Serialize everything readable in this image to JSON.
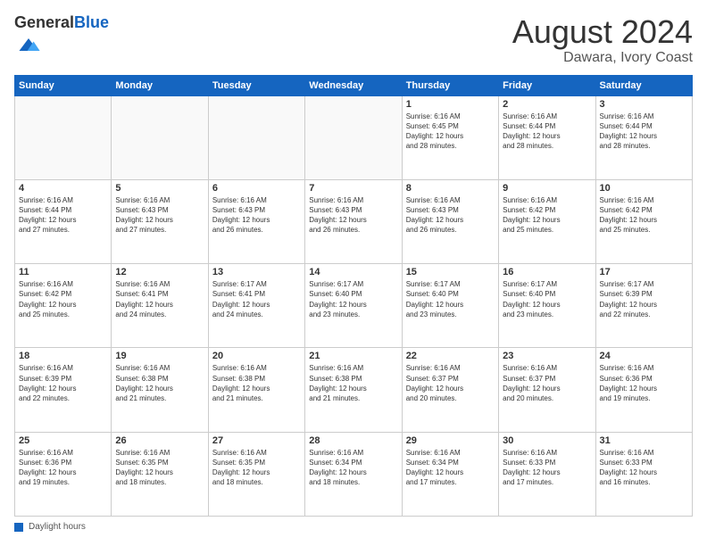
{
  "logo": {
    "general": "General",
    "blue": "Blue"
  },
  "header": {
    "month": "August 2024",
    "location": "Dawara, Ivory Coast"
  },
  "days_of_week": [
    "Sunday",
    "Monday",
    "Tuesday",
    "Wednesday",
    "Thursday",
    "Friday",
    "Saturday"
  ],
  "footer": {
    "daylight_hours_label": "Daylight hours"
  },
  "weeks": [
    [
      {
        "day": "",
        "info": ""
      },
      {
        "day": "",
        "info": ""
      },
      {
        "day": "",
        "info": ""
      },
      {
        "day": "",
        "info": ""
      },
      {
        "day": "1",
        "info": "Sunrise: 6:16 AM\nSunset: 6:45 PM\nDaylight: 12 hours\nand 28 minutes."
      },
      {
        "day": "2",
        "info": "Sunrise: 6:16 AM\nSunset: 6:44 PM\nDaylight: 12 hours\nand 28 minutes."
      },
      {
        "day": "3",
        "info": "Sunrise: 6:16 AM\nSunset: 6:44 PM\nDaylight: 12 hours\nand 28 minutes."
      }
    ],
    [
      {
        "day": "4",
        "info": "Sunrise: 6:16 AM\nSunset: 6:44 PM\nDaylight: 12 hours\nand 27 minutes."
      },
      {
        "day": "5",
        "info": "Sunrise: 6:16 AM\nSunset: 6:43 PM\nDaylight: 12 hours\nand 27 minutes."
      },
      {
        "day": "6",
        "info": "Sunrise: 6:16 AM\nSunset: 6:43 PM\nDaylight: 12 hours\nand 26 minutes."
      },
      {
        "day": "7",
        "info": "Sunrise: 6:16 AM\nSunset: 6:43 PM\nDaylight: 12 hours\nand 26 minutes."
      },
      {
        "day": "8",
        "info": "Sunrise: 6:16 AM\nSunset: 6:43 PM\nDaylight: 12 hours\nand 26 minutes."
      },
      {
        "day": "9",
        "info": "Sunrise: 6:16 AM\nSunset: 6:42 PM\nDaylight: 12 hours\nand 25 minutes."
      },
      {
        "day": "10",
        "info": "Sunrise: 6:16 AM\nSunset: 6:42 PM\nDaylight: 12 hours\nand 25 minutes."
      }
    ],
    [
      {
        "day": "11",
        "info": "Sunrise: 6:16 AM\nSunset: 6:42 PM\nDaylight: 12 hours\nand 25 minutes."
      },
      {
        "day": "12",
        "info": "Sunrise: 6:16 AM\nSunset: 6:41 PM\nDaylight: 12 hours\nand 24 minutes."
      },
      {
        "day": "13",
        "info": "Sunrise: 6:17 AM\nSunset: 6:41 PM\nDaylight: 12 hours\nand 24 minutes."
      },
      {
        "day": "14",
        "info": "Sunrise: 6:17 AM\nSunset: 6:40 PM\nDaylight: 12 hours\nand 23 minutes."
      },
      {
        "day": "15",
        "info": "Sunrise: 6:17 AM\nSunset: 6:40 PM\nDaylight: 12 hours\nand 23 minutes."
      },
      {
        "day": "16",
        "info": "Sunrise: 6:17 AM\nSunset: 6:40 PM\nDaylight: 12 hours\nand 23 minutes."
      },
      {
        "day": "17",
        "info": "Sunrise: 6:17 AM\nSunset: 6:39 PM\nDaylight: 12 hours\nand 22 minutes."
      }
    ],
    [
      {
        "day": "18",
        "info": "Sunrise: 6:16 AM\nSunset: 6:39 PM\nDaylight: 12 hours\nand 22 minutes."
      },
      {
        "day": "19",
        "info": "Sunrise: 6:16 AM\nSunset: 6:38 PM\nDaylight: 12 hours\nand 21 minutes."
      },
      {
        "day": "20",
        "info": "Sunrise: 6:16 AM\nSunset: 6:38 PM\nDaylight: 12 hours\nand 21 minutes."
      },
      {
        "day": "21",
        "info": "Sunrise: 6:16 AM\nSunset: 6:38 PM\nDaylight: 12 hours\nand 21 minutes."
      },
      {
        "day": "22",
        "info": "Sunrise: 6:16 AM\nSunset: 6:37 PM\nDaylight: 12 hours\nand 20 minutes."
      },
      {
        "day": "23",
        "info": "Sunrise: 6:16 AM\nSunset: 6:37 PM\nDaylight: 12 hours\nand 20 minutes."
      },
      {
        "day": "24",
        "info": "Sunrise: 6:16 AM\nSunset: 6:36 PM\nDaylight: 12 hours\nand 19 minutes."
      }
    ],
    [
      {
        "day": "25",
        "info": "Sunrise: 6:16 AM\nSunset: 6:36 PM\nDaylight: 12 hours\nand 19 minutes."
      },
      {
        "day": "26",
        "info": "Sunrise: 6:16 AM\nSunset: 6:35 PM\nDaylight: 12 hours\nand 18 minutes."
      },
      {
        "day": "27",
        "info": "Sunrise: 6:16 AM\nSunset: 6:35 PM\nDaylight: 12 hours\nand 18 minutes."
      },
      {
        "day": "28",
        "info": "Sunrise: 6:16 AM\nSunset: 6:34 PM\nDaylight: 12 hours\nand 18 minutes."
      },
      {
        "day": "29",
        "info": "Sunrise: 6:16 AM\nSunset: 6:34 PM\nDaylight: 12 hours\nand 17 minutes."
      },
      {
        "day": "30",
        "info": "Sunrise: 6:16 AM\nSunset: 6:33 PM\nDaylight: 12 hours\nand 17 minutes."
      },
      {
        "day": "31",
        "info": "Sunrise: 6:16 AM\nSunset: 6:33 PM\nDaylight: 12 hours\nand 16 minutes."
      }
    ]
  ]
}
